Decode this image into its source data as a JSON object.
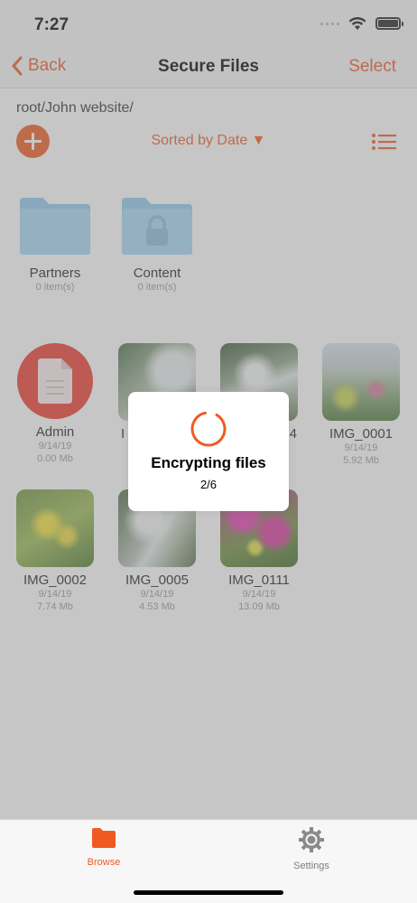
{
  "status_bar": {
    "time": "7:27"
  },
  "nav": {
    "back_label": "Back",
    "title": "Secure Files",
    "select_label": "Select"
  },
  "browser": {
    "path": "root/John website/",
    "sort_label": "Sorted by Date ▼"
  },
  "folders": [
    {
      "name": "Partners",
      "count": "0 item(s)",
      "locked": false
    },
    {
      "name": "Content",
      "count": "0 item(s)",
      "locked": true
    }
  ],
  "files": [
    {
      "name": "Admin",
      "date": "9/14/19",
      "size": "0.00 Mb",
      "kind": "document"
    },
    {
      "name": "I",
      "date": "",
      "size": "",
      "kind": "image-waterfall"
    },
    {
      "name": "4",
      "date": "",
      "size": "",
      "kind": "image-cascade"
    },
    {
      "name": "IMG_0001",
      "date": "9/14/19",
      "size": "5.92 Mb",
      "kind": "image-meadow"
    },
    {
      "name": "IMG_0002",
      "date": "9/14/19",
      "size": "7.74 Mb",
      "kind": "image-flowers"
    },
    {
      "name": "IMG_0005",
      "date": "9/14/19",
      "size": "4.53 Mb",
      "kind": "image-falls"
    },
    {
      "name": "IMG_0111",
      "date": "9/14/19",
      "size": "13.09 Mb",
      "kind": "image-pink-flowers"
    }
  ],
  "progress": {
    "title": "Encrypting files",
    "count": "2/6",
    "done": 2,
    "total": 6
  },
  "tabs": [
    {
      "label": "Browse",
      "icon": "folder-icon",
      "active": true
    },
    {
      "label": "Settings",
      "icon": "gear-icon",
      "active": false
    }
  ],
  "colors": {
    "accent": "#f05a22",
    "folder": "#8ecbee",
    "document": "#ee3b30"
  }
}
